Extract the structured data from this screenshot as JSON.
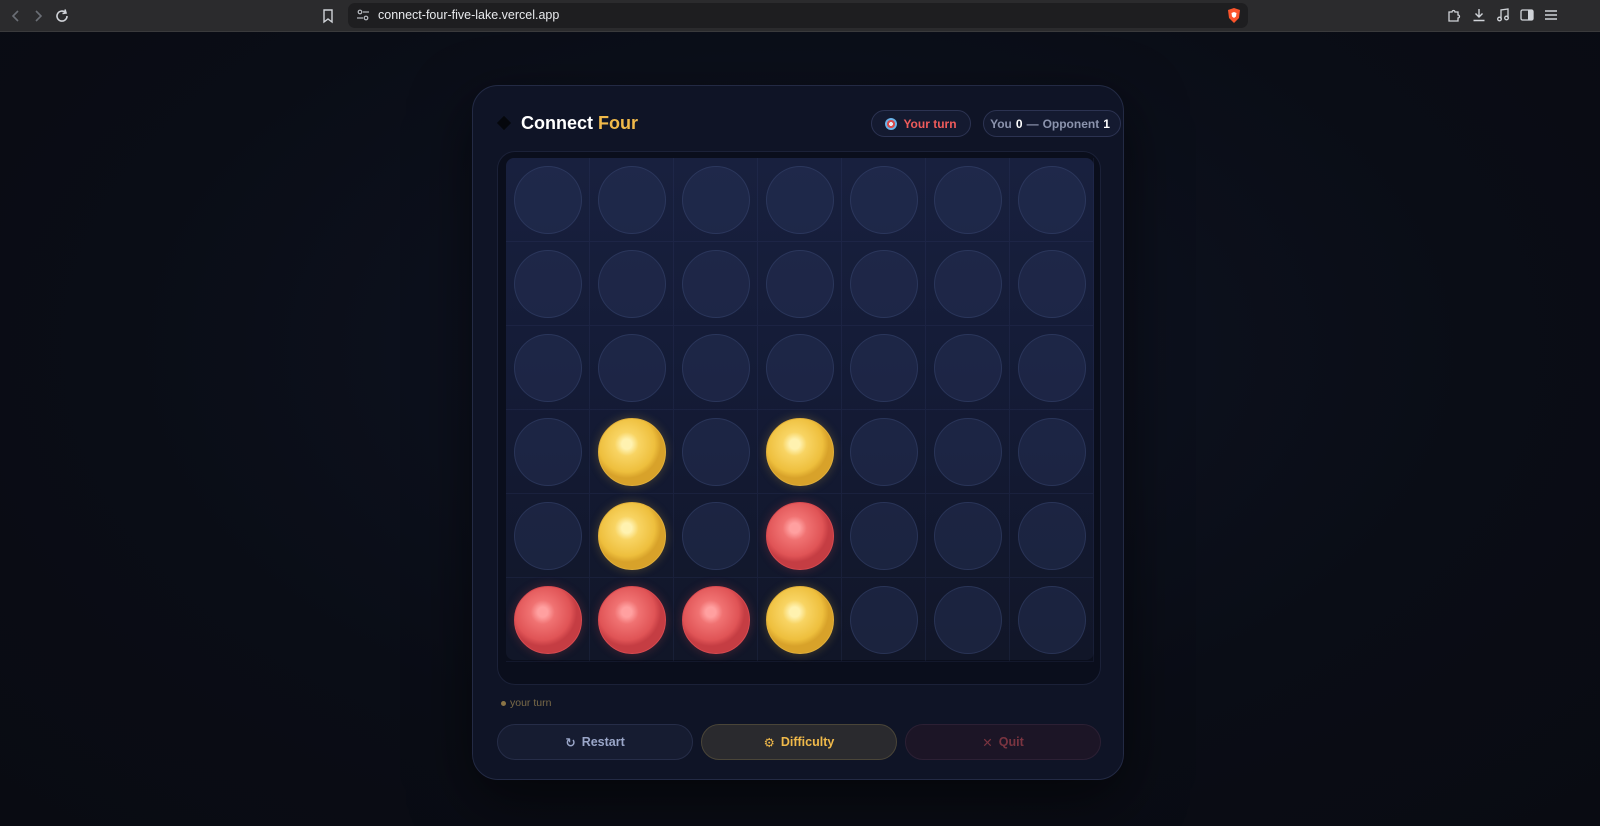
{
  "browser": {
    "url": "connect-four-five-lake.vercel.app"
  },
  "header": {
    "title_main": "Connect",
    "title_accent": "Four",
    "turn_label": "Your turn",
    "score_you_label": "You",
    "score_you": "0",
    "score_separator": "—",
    "score_opponent_label": "Opponent",
    "score_opponent": "1"
  },
  "board": {
    "columns": 7,
    "rows": 6,
    "cells": [
      [
        "",
        "",
        "",
        "",
        "",
        "",
        ""
      ],
      [
        "",
        "",
        "",
        "",
        "",
        "",
        ""
      ],
      [
        "",
        "",
        "",
        "",
        "",
        "",
        ""
      ],
      [
        "",
        "yellow",
        "",
        "yellow",
        "",
        "",
        ""
      ],
      [
        "",
        "yellow",
        "",
        "red",
        "",
        "",
        ""
      ],
      [
        "red",
        "red",
        "red",
        "yellow",
        "",
        "",
        ""
      ]
    ]
  },
  "status": {
    "text": "your turn"
  },
  "actions": {
    "restart_label": "Restart",
    "restart_icon": "↻",
    "difficulty_label": "Difficulty",
    "difficulty_icon": "⚙",
    "quit_label": "Quit",
    "quit_icon": "✕"
  },
  "colors": {
    "accent": "#f0b94a",
    "red_piece": "#e05456",
    "yellow_piece": "#eebf3d",
    "turn_text": "#ef5b5b"
  }
}
